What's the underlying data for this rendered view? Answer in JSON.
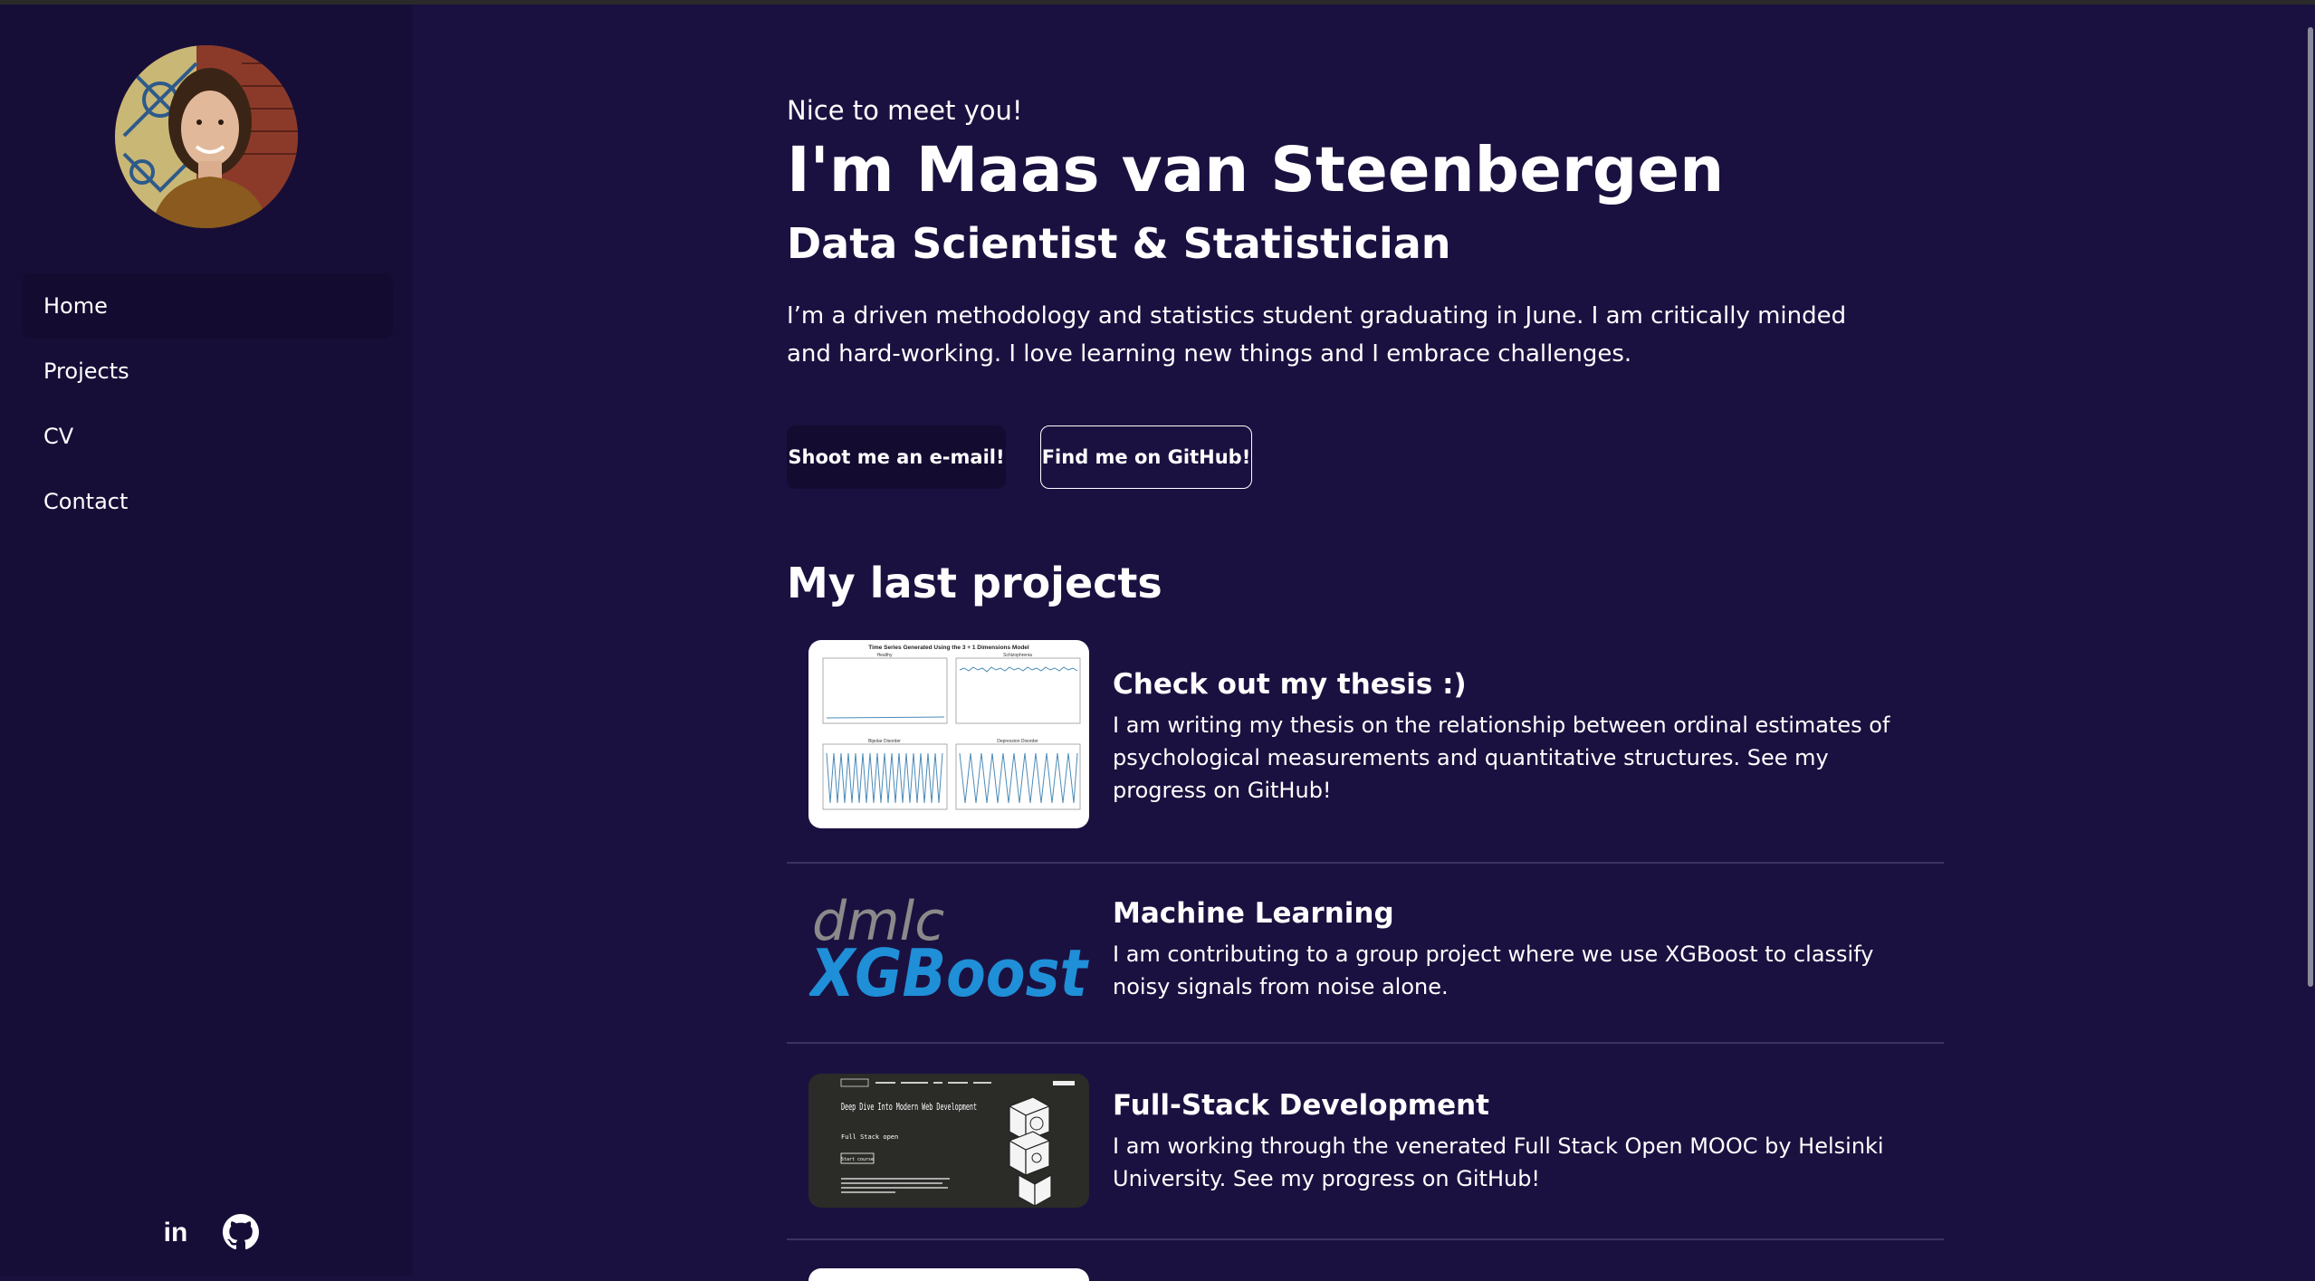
{
  "sidebar": {
    "avatar_alt": "Profile photo",
    "nav": [
      {
        "label": "Home",
        "active": true
      },
      {
        "label": "Projects",
        "active": false
      },
      {
        "label": "CV",
        "active": false
      },
      {
        "label": "Contact",
        "active": false
      }
    ],
    "socials": [
      {
        "icon": "linkedin-icon",
        "label": "in"
      },
      {
        "icon": "github-icon"
      }
    ]
  },
  "hero": {
    "greeting": "Nice to meet you!",
    "name": "I'm Maas van Steenbergen",
    "role": "Data Scientist & Statistician",
    "intro": "I’m a driven methodology and statistics student graduating in June. I am critically minded and hard-working. I love learning new things and I embrace challenges.",
    "email_button": "Shoot me an e-mail!",
    "github_button": "Find me on GitHub!"
  },
  "projects": {
    "section_title": "My last projects",
    "items": [
      {
        "title": "Check out my thesis :)",
        "description": "I am writing my thesis on the relationship between ordinal estimates of psychological measurements and quantitative structures. See my progress on GitHub!",
        "thumb": {
          "title": "Time Series Generated Using the 3 + 1 Dimensions Model",
          "panels": [
            "Healthy",
            "Schizophrenia",
            "Bipolar Disorder",
            "Depression Disorder"
          ]
        }
      },
      {
        "title": "Machine Learning",
        "description": "I am contributing to a group project where we use XGBoost to classify noisy signals from noise alone.",
        "thumb": {
          "top": "dmlc",
          "bottom": "XGBoost"
        }
      },
      {
        "title": "Full-Stack Development",
        "description": "I am working through the venerated Full Stack Open MOOC by Helsinki University. See my progress on GitHub!",
        "thumb": {
          "heading": "Deep Dive Into Modern Web Development",
          "sub": "Full Stack open",
          "button": "Start course"
        }
      }
    ]
  },
  "colors": {
    "background": "#1b1140",
    "sidebar": "#170e38",
    "active_nav": "#140b31",
    "text": "#ffffff",
    "xgboost_blue": "#1f8fd8"
  }
}
